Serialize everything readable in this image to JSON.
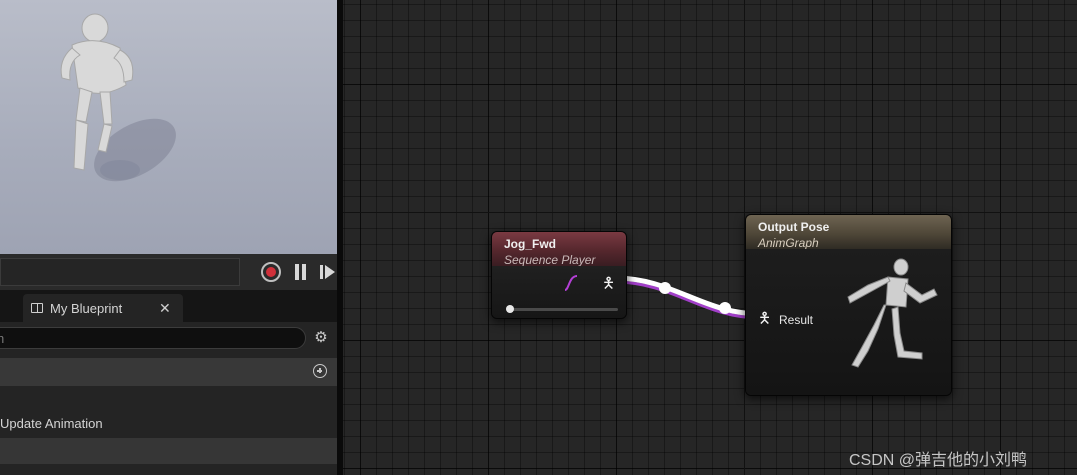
{
  "playback": {
    "record_icon": "record-icon",
    "pause_icon": "pause-icon",
    "step_icon": "step-forward-icon"
  },
  "tabs": [
    {
      "label": "My Blueprint",
      "icon": "book-icon",
      "close": "✕"
    }
  ],
  "my_blueprint": {
    "search_placeholder": "h",
    "items": [
      "Update Animation"
    ]
  },
  "graph": {
    "nodes": [
      {
        "title": "Jog_Fwd",
        "subtitle": "Sequence Player",
        "header_color": "#6b333a"
      },
      {
        "title": "Output Pose",
        "subtitle": "AnimGraph",
        "header_color": "#5e5646",
        "pin_label": "Result"
      }
    ],
    "wire_colors": {
      "pose": "#ffffff",
      "secondary": "#a23fc9"
    }
  },
  "watermark": "CSDN @弹吉他的小刘鸭"
}
